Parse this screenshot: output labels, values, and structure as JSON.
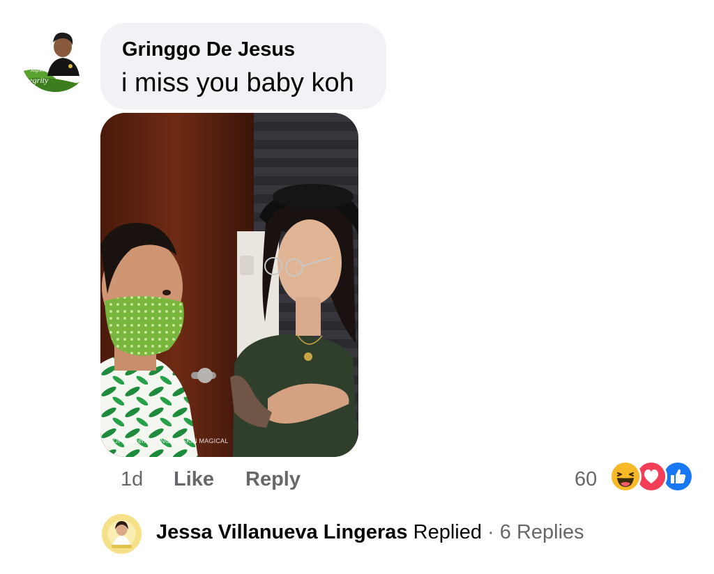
{
  "comment": {
    "author": "Gringgo De Jesus",
    "text": "i miss you baby koh",
    "photo_watermark": "OPPO Reno ... INGGO SKIN MAGICAL",
    "avatar_text": "Soaring Higher Integrity",
    "time": "1d",
    "like_label": "Like",
    "reply_label": "Reply",
    "reaction_count": "60",
    "reactions": [
      "haha-icon",
      "love-icon",
      "like-icon"
    ]
  },
  "reply_preview": {
    "name": "Jessa Villanueva Lingeras",
    "status": "Replied",
    "separator": "·",
    "replies_count": "6 Replies"
  },
  "colors": {
    "bubble": "#f0f2f5",
    "secondary_text": "#65676b",
    "like_blue": "#1877f2",
    "love_red": "#f33e58",
    "haha_yellow": "#f7b928"
  }
}
